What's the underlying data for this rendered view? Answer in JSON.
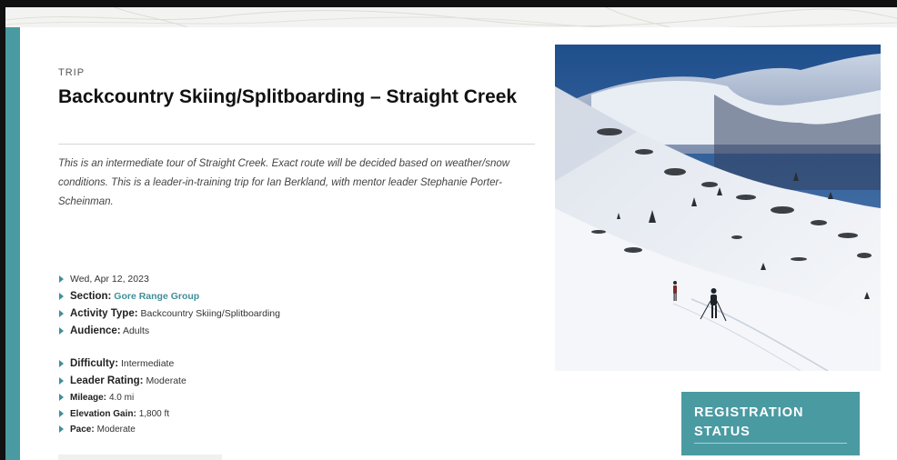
{
  "trip": {
    "eyebrow": "TRIP",
    "title": "Backcountry Skiing/Splitboarding – Straight Creek",
    "description": "This is an intermediate tour of Straight Creek. Exact route will be decided based on weather/snow conditions. This is a leader-in-training trip for Ian Berkland, with mentor leader Stephanie Porter-Scheinman."
  },
  "details_primary": {
    "date": "Wed, Apr 12, 2023",
    "section_label": "Section:",
    "section_value": "Gore Range Group",
    "activity_label": "Activity Type:",
    "activity_value": "Backcountry Skiing/Splitboarding",
    "audience_label": "Audience:",
    "audience_value": "Adults"
  },
  "details_secondary": {
    "difficulty_label": "Difficulty:",
    "difficulty_value": "Intermediate",
    "leader_rating_label": "Leader Rating:",
    "leader_rating_value": "Moderate",
    "mileage_label": "Mileage:",
    "mileage_value": "4.0 mi",
    "elevation_label": "Elevation Gain:",
    "elevation_value": "1,800 ft",
    "pace_label": "Pace:",
    "pace_value": "Moderate"
  },
  "registration": {
    "title": "REGISTRATION STATUS"
  },
  "colors": {
    "accent": "#4a9aa2",
    "link": "#3f8f99",
    "title": "#111111"
  },
  "icons": {
    "bullet": "triangle-bullet-icon"
  }
}
